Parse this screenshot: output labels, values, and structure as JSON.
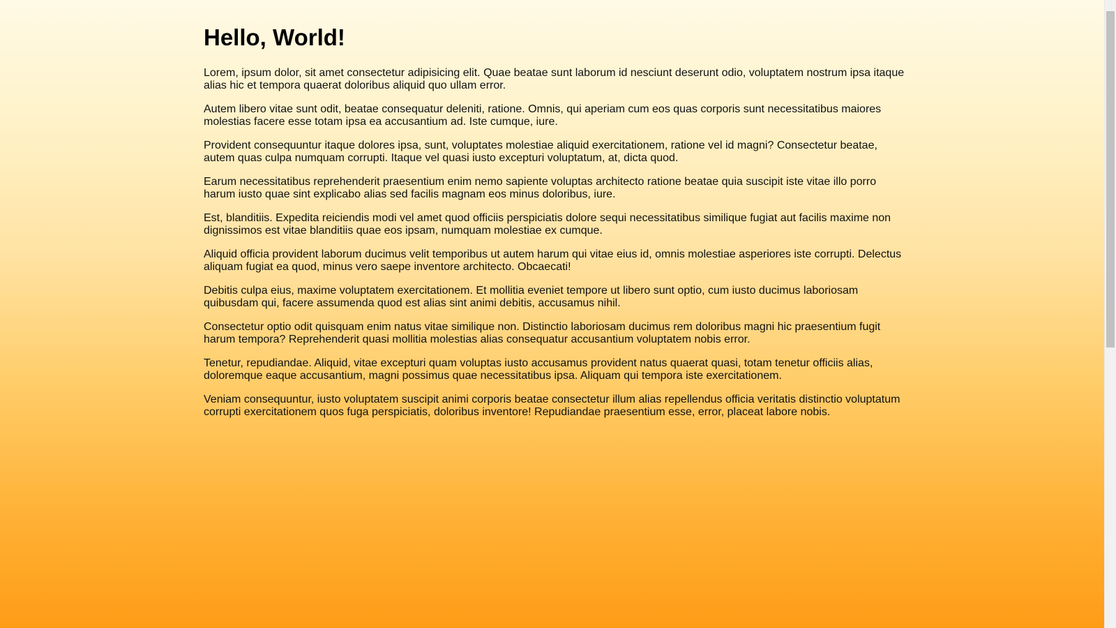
{
  "page": {
    "title": "Hello, World!",
    "paragraphs": [
      "Lorem, ipsum dolor, sit amet consectetur adipisicing elit. Quae beatae sunt laborum id nesciunt deserunt odio, voluptatem nostrum ipsa itaque alias hic et tempora quaerat doloribus aliquid quo ullam error.",
      "Autem libero vitae sunt odit, beatae consequatur deleniti, ratione. Omnis, qui aperiam cum eos quas corporis sunt necessitatibus maiores molestias facere esse totam ipsa ea accusantium ad. Iste cumque, iure.",
      "Provident consequuntur itaque dolores ipsa, sunt, voluptates molestiae aliquid exercitationem, ratione vel id magni? Consectetur beatae, autem quas culpa numquam corrupti. Itaque vel quasi iusto excepturi voluptatum, at, dicta quod.",
      "Earum necessitatibus reprehenderit praesentium enim nemo sapiente voluptas architecto ratione beatae quia suscipit iste vitae illo porro harum iusto quae sint explicabo alias sed facilis magnam eos minus doloribus, iure.",
      "Est, blanditiis. Expedita reiciendis modi vel amet quod officiis perspiciatis dolore sequi necessitatibus similique fugiat aut facilis maxime non dignissimos est vitae blanditiis quae eos ipsam, numquam molestiae ex cumque.",
      "Aliquid officia provident laborum ducimus velit temporibus ut autem harum qui vitae eius id, omnis molestiae asperiores iste corrupti. Delectus aliquam fugiat ea quod, minus vero saepe inventore architecto. Obcaecati!",
      "Debitis culpa eius, maxime voluptatem exercitationem. Et mollitia eveniet tempore ut libero sunt optio, cum iusto ducimus laboriosam quibusdam qui, facere assumenda quod est alias sint animi debitis, accusamus nihil.",
      "Consectetur optio odit quisquam enim natus vitae similique non. Distinctio laboriosam ducimus rem doloribus magni hic praesentium fugit harum tempora? Reprehenderit quasi mollitia molestias alias consequatur accusantium voluptatem nobis error.",
      "Tenetur, repudiandae. Aliquid, vitae excepturi quam voluptas iusto accusamus provident natus quaerat quasi, totam tenetur officiis alias, doloremque eaque accusantium, magni possimus quae necessitatibus ipsa. Aliquam qui tempora iste exercitationem.",
      "Veniam consequuntur, iusto voluptatem suscipit animi corporis beatae consectetur illum alias repellendus officia veritatis distinctio voluptatum corrupti exercitationem quos fuga perspiciatis, doloribus inventore! Repudiandae praesentium esse, error, placeat labore nobis."
    ]
  },
  "colors": {
    "gradient_top": "#fffae6",
    "gradient_bottom": "#ff9c16",
    "text": "#111111",
    "scrollbar_track": "#f1f1f1",
    "scrollbar_thumb": "#c1c1c1"
  }
}
